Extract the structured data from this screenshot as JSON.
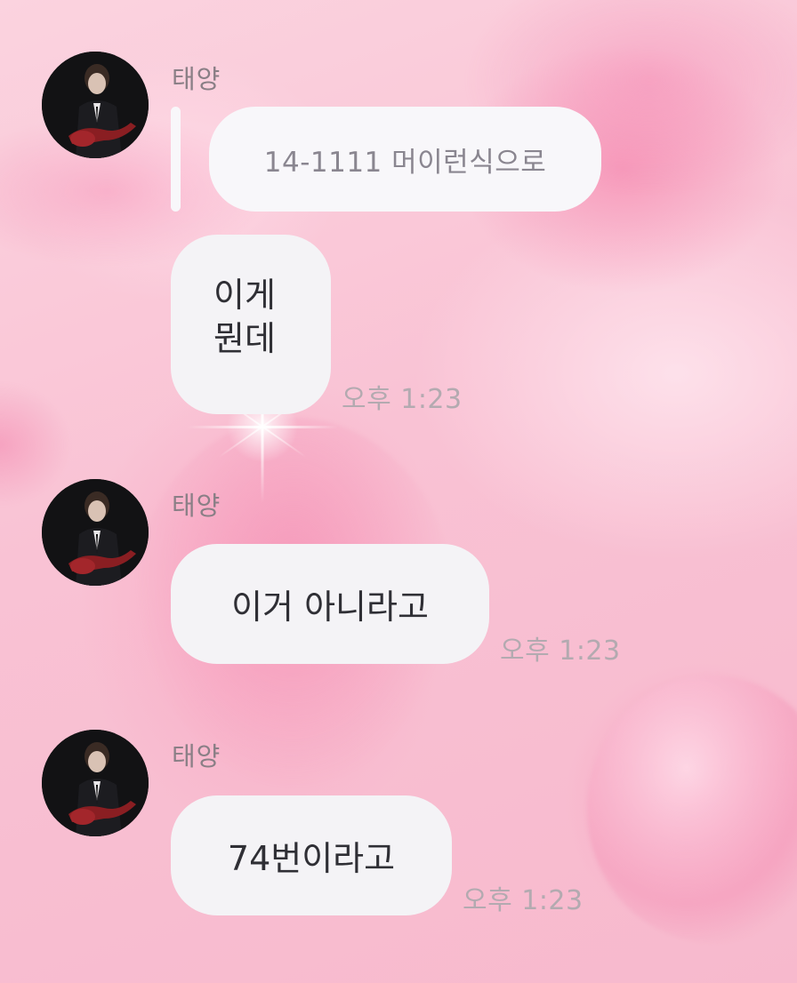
{
  "messages": [
    {
      "sender": "태양",
      "reply_preview": "14-1111 머이런식으로",
      "lines": [
        "이게",
        "뭔데"
      ],
      "time": "오후 1:23"
    },
    {
      "sender": "태양",
      "text": "이거 아니라고",
      "time": "오후 1:23"
    },
    {
      "sender": "태양",
      "text": "74번이라고",
      "time": "오후 1:23"
    }
  ],
  "icons": {
    "avatar": "profile-photo-guitarist"
  },
  "colors": {
    "bubble": "#f4f3f6",
    "background": "#f9c6d6",
    "sender_text": "#8a7f86",
    "time_text": "#b3aab0"
  }
}
